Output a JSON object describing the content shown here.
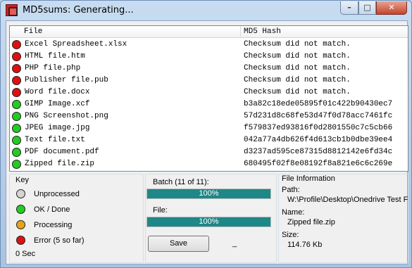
{
  "window": {
    "title": "MD5sums: Generating...",
    "minimize_glyph": "–",
    "maximize_glyph": "□",
    "close_glyph": "✕"
  },
  "list": {
    "columns": [
      "File",
      "MD5 Hash"
    ],
    "rows": [
      {
        "file": "Excel Spreadsheet.xlsx",
        "hash": "Checksum did not match.",
        "status": "error"
      },
      {
        "file": "HTML file.htm",
        "hash": "Checksum did not match.",
        "status": "error"
      },
      {
        "file": "PHP file.php",
        "hash": "Checksum did not match.",
        "status": "error"
      },
      {
        "file": "Publisher file.pub",
        "hash": "Checksum did not match.",
        "status": "error"
      },
      {
        "file": "Word file.docx",
        "hash": "Checksum did not match.",
        "status": "error"
      },
      {
        "file": "GIMP Image.xcf",
        "hash": "b3a82c18ede05895f01c422b90430ec7",
        "status": "ok"
      },
      {
        "file": "PNG Screenshot.png",
        "hash": "57d231d8c68fe53d47f0d78acc7461fc",
        "status": "ok"
      },
      {
        "file": "JPEG image.jpg",
        "hash": "f579837ed93816f0d2801550c7c5cb66",
        "status": "ok"
      },
      {
        "file": "Text file.txt",
        "hash": "042a77a4db626f4d613cb1b0dbe39ee4",
        "status": "ok"
      },
      {
        "file": "PDF document.pdf",
        "hash": "d3237ad595ce87315d8812142e6fd34c",
        "status": "ok"
      },
      {
        "file": "Zipped file.zip",
        "hash": "680495f02f8e08192f8a821e6c6c269e",
        "status": "ok"
      }
    ]
  },
  "key": {
    "title": "Key",
    "items": [
      {
        "label": "Unprocessed",
        "color": "#d4d4d4"
      },
      {
        "label": "OK / Done",
        "color": "#22cc22"
      },
      {
        "label": "Processing",
        "color": "#e8a317"
      },
      {
        "label": "Error  (5 so far)",
        "color": "#dd1111"
      }
    ],
    "elapsed": "0 Sec"
  },
  "progress": {
    "batch_label": "Batch (11 of 11):",
    "batch_percent": 100,
    "batch_text": "100%",
    "file_label": "File:",
    "file_percent": 100,
    "file_text": "100%",
    "save_label": "Save",
    "cursor_mark": "_"
  },
  "file_info": {
    "title": "File Information",
    "path_label": "Path:",
    "path_value": "W:\\Profile\\Desktop\\Onedrive Test F",
    "name_label": "Name:",
    "name_value": "Zipped file.zip",
    "size_label": "Size:",
    "size_value": "114.76 Kb"
  },
  "colors": {
    "error": "#dd1111",
    "ok": "#22cc22",
    "progress_fill": "#1e8787"
  }
}
